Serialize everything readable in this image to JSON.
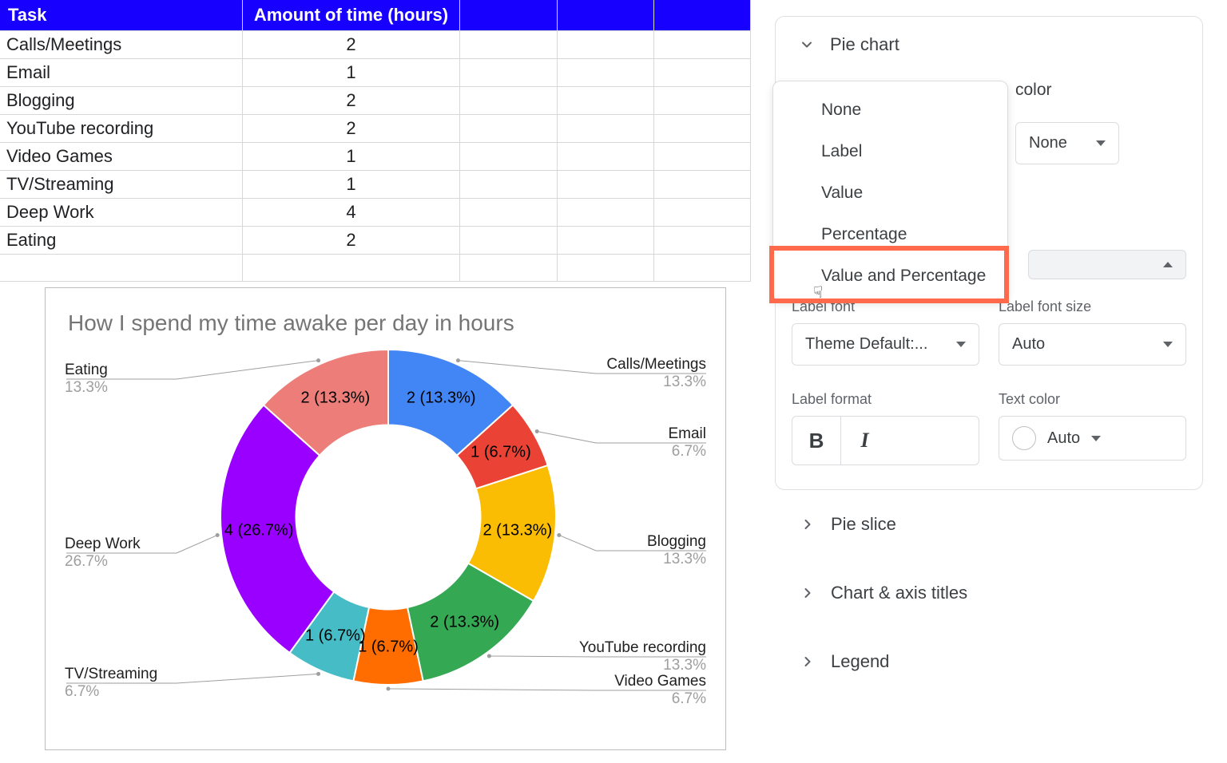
{
  "table": {
    "headers": [
      "Task",
      "Amount of time (hours)"
    ],
    "rows": [
      [
        "Calls/Meetings",
        "2"
      ],
      [
        "Email",
        "1"
      ],
      [
        "Blogging",
        "2"
      ],
      [
        "YouTube recording",
        "2"
      ],
      [
        "Video Games",
        "1"
      ],
      [
        "TV/Streaming",
        "1"
      ],
      [
        "Deep Work",
        "4"
      ],
      [
        "Eating",
        "2"
      ]
    ]
  },
  "chart_data": {
    "type": "pie",
    "title": "How I spend my time awake per day in hours",
    "donut_hole": 0.55,
    "series": [
      {
        "label": "Calls/Meetings",
        "value": 2,
        "percent": 13.3,
        "color": "#4285f4"
      },
      {
        "label": "Email",
        "value": 1,
        "percent": 6.7,
        "color": "#ea4335"
      },
      {
        "label": "Blogging",
        "value": 2,
        "percent": 13.3,
        "color": "#fbbc04"
      },
      {
        "label": "YouTube recording",
        "value": 2,
        "percent": 13.3,
        "color": "#34a853"
      },
      {
        "label": "Video Games",
        "value": 1,
        "percent": 6.7,
        "color": "#ff6d01"
      },
      {
        "label": "TV/Streaming",
        "value": 1,
        "percent": 6.7,
        "color": "#46bdc6"
      },
      {
        "label": "Deep Work",
        "value": 4,
        "percent": 26.7,
        "color": "#9900ff"
      },
      {
        "label": "Eating",
        "value": 2,
        "percent": 13.3,
        "color": "#ed7d78"
      }
    ]
  },
  "panel": {
    "section_title": "Pie chart",
    "slice_label_options": [
      "None",
      "Label",
      "Value",
      "Percentage",
      "Value and Percentage"
    ],
    "slice_label_selected": "Value and Percentage",
    "border_color_label": "color",
    "border_color_value": "None",
    "label_font_label": "Label font",
    "label_font_value": "Theme Default:...",
    "label_font_size_label": "Label font size",
    "label_font_size_value": "Auto",
    "label_format_label": "Label format",
    "text_color_label": "Text color",
    "text_color_value": "Auto",
    "accordion": [
      "Pie slice",
      "Chart & axis titles",
      "Legend"
    ]
  }
}
